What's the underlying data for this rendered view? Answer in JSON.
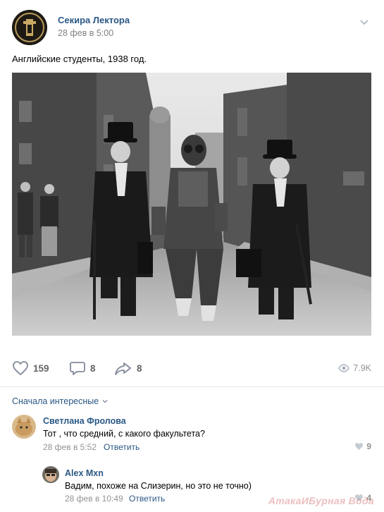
{
  "post": {
    "author": "Секира Лектора",
    "date": "28 фев в 5:00",
    "text": "Английские студенты, 1938 год."
  },
  "actions": {
    "likes": "159",
    "comments": "8",
    "shares": "8",
    "views": "7.9K"
  },
  "comments_sort": "Сначала интересные",
  "comments": [
    {
      "author": "Светлана Фролова",
      "text": "Тот , что средний, с какого факультета?",
      "date": "28 фев в 5:52",
      "reply_label": "Ответить",
      "likes": "9"
    },
    {
      "author": "Alex Mxn",
      "text": "Вадим, похоже на Слизерин, но это не точно)",
      "date": "28 фев в 10:49",
      "reply_label": "Ответить",
      "likes": "4"
    }
  ],
  "watermark": "АтакаИБурная Вода",
  "colors": {
    "link": "#2a5885",
    "muted": "#939393",
    "separator": "#e7e8ec"
  },
  "icons": [
    "chevron-down-icon",
    "heart-icon",
    "comment-icon",
    "share-icon",
    "eye-icon"
  ]
}
